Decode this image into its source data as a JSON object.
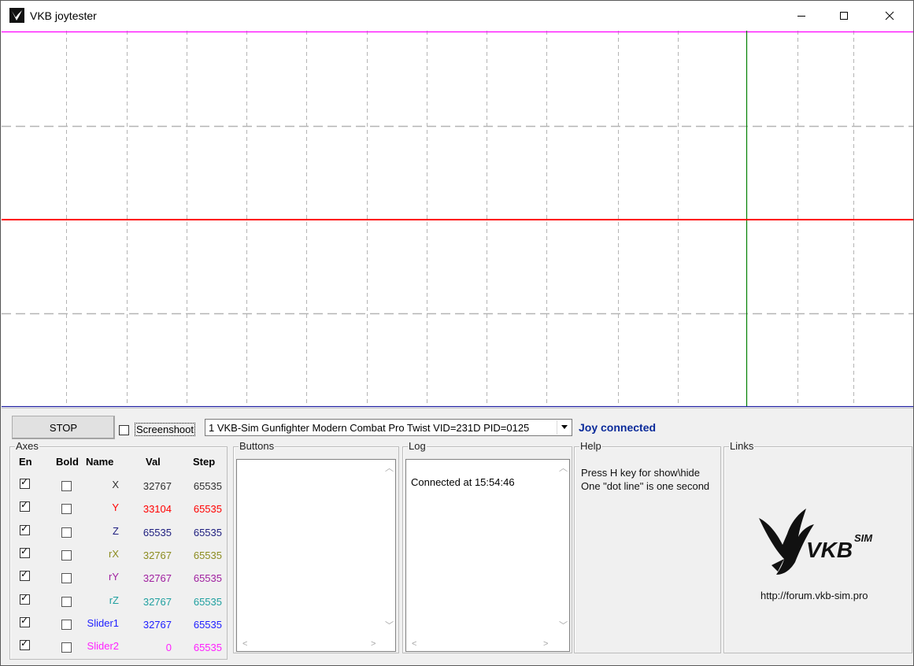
{
  "window": {
    "title": "VKB joytester"
  },
  "graph": {
    "colors": {
      "top_line": "#ff00ff",
      "center_line": "#ff0000",
      "cursor_line": "#008000",
      "bottom_line": "#2020a0",
      "grid": "#b4b4b4"
    }
  },
  "controls": {
    "stop_label": "STOP",
    "screenshot_label": "Screenshoot",
    "screenshot_checked": false,
    "device_selected": "1  VKB-Sim Gunfighter Modern Combat Pro Twist  VID=231D PID=0125",
    "joy_status": "Joy connected"
  },
  "axes": {
    "legend": "Axes",
    "headers": {
      "en": "En",
      "bold": "Bold",
      "name": "Name",
      "val": "Val",
      "step": "Step"
    },
    "rows": [
      {
        "name": "X",
        "val": "32767",
        "step": "65535",
        "color": "#303030",
        "enabled": true,
        "bold": false
      },
      {
        "name": "Y",
        "val": "33104",
        "step": "65535",
        "color": "#ff0000",
        "enabled": true,
        "bold": false
      },
      {
        "name": "Z",
        "val": "65535",
        "step": "65535",
        "color": "#202080",
        "enabled": true,
        "bold": false
      },
      {
        "name": "rX",
        "val": "32767",
        "step": "65535",
        "color": "#8c8c20",
        "enabled": true,
        "bold": false
      },
      {
        "name": "rY",
        "val": "32767",
        "step": "65535",
        "color": "#a020a0",
        "enabled": true,
        "bold": false
      },
      {
        "name": "rZ",
        "val": "32767",
        "step": "65535",
        "color": "#20a0a0",
        "enabled": true,
        "bold": false
      },
      {
        "name": "Slider1",
        "val": "32767",
        "step": "65535",
        "color": "#2020ff",
        "enabled": true,
        "bold": false
      },
      {
        "name": "Slider2",
        "val": "0",
        "step": "65535",
        "color": "#ff20ff",
        "enabled": true,
        "bold": false
      }
    ]
  },
  "buttons_panel": {
    "legend": "Buttons"
  },
  "log_panel": {
    "legend": "Log",
    "entries": [
      "Connected at 15:54:46"
    ]
  },
  "help_panel": {
    "legend": "Help",
    "line1": "Press H key for show\\hide",
    "line2": "One \"dot line\" is one second"
  },
  "links_panel": {
    "legend": "Links",
    "logo_text": "VKB",
    "logo_superscript": "SIM",
    "url": "http://forum.vkb-sim.pro"
  }
}
